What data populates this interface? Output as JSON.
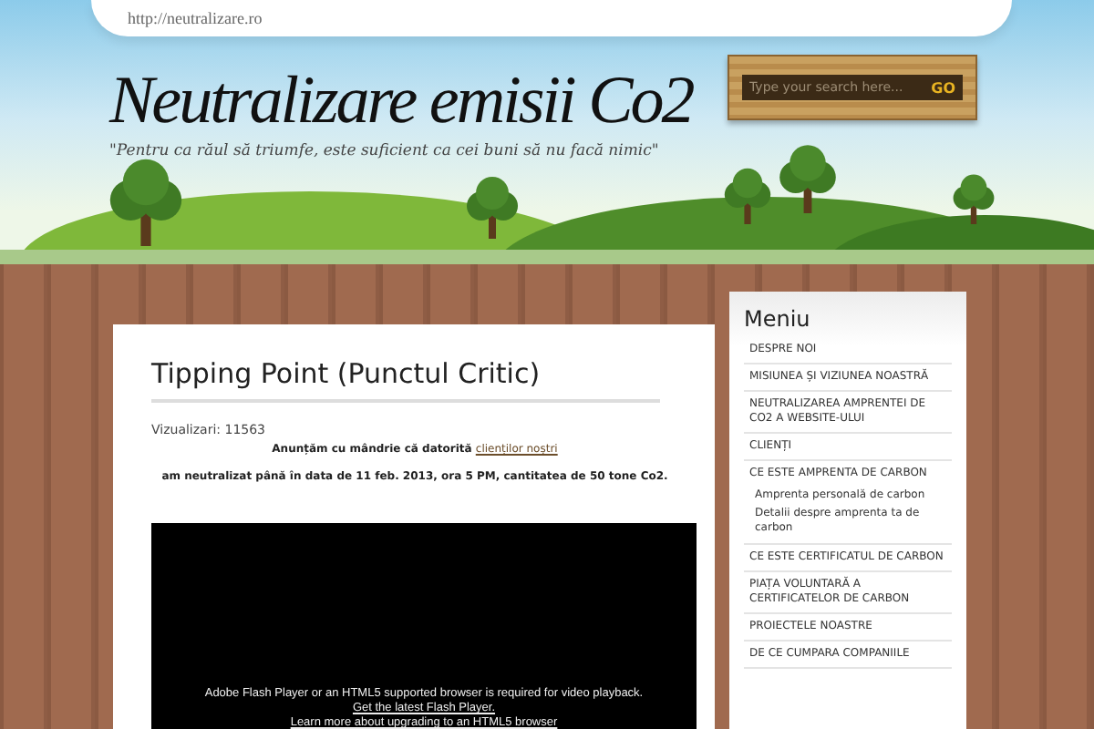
{
  "header": {
    "url": "http://neutralizare.ro",
    "title": "Neutralizare emisii Co2",
    "tagline": "\"Pentru ca răul să triumfe, este suficient ca cei buni să nu facă nimic\"",
    "search": {
      "placeholder": "Type your search here...",
      "button": "GO"
    }
  },
  "post": {
    "title": "Tipping Point (Punctul Critic)",
    "views": "Vizualizari: 11563",
    "intro": "Anunțăm cu mândrie că datorită",
    "intro_link": "clienților noștri",
    "statement": "am neutralizat până în data de 11 feb. 2013, ora 5 PM, cantitatea de 50 tone Co2.",
    "video": {
      "message": "Adobe Flash Player or an HTML5 supported browser is required for video playback.",
      "links": [
        "Get the latest Flash Player.",
        "Learn more about upgrading to an HTML5 browser"
      ]
    }
  },
  "sidebar": {
    "title": "Meniu",
    "items": [
      {
        "label": "DESPRE NOI"
      },
      {
        "label": "MISIUNEA ȘI VIZIUNEA NOASTRĂ"
      },
      {
        "label": "NEUTRALIZAREA AMPRENTEI DE CO2 A WEBSITE-ULUI"
      },
      {
        "label": "CLIENȚI"
      },
      {
        "label": "CE ESTE AMPRENTA DE CARBON",
        "children": [
          {
            "label": "Amprenta personală de carbon"
          },
          {
            "label": "Detalii despre amprenta ta de carbon"
          }
        ]
      },
      {
        "label": "CE ESTE CERTIFICATUL DE CARBON"
      },
      {
        "label": "PIAȚA VOLUNTARĂ A CERTIFICATELOR DE CARBON"
      },
      {
        "label": "PROIECTELE NOASTRE"
      },
      {
        "label": "DE CE CUMPARA COMPANIILE"
      }
    ]
  }
}
